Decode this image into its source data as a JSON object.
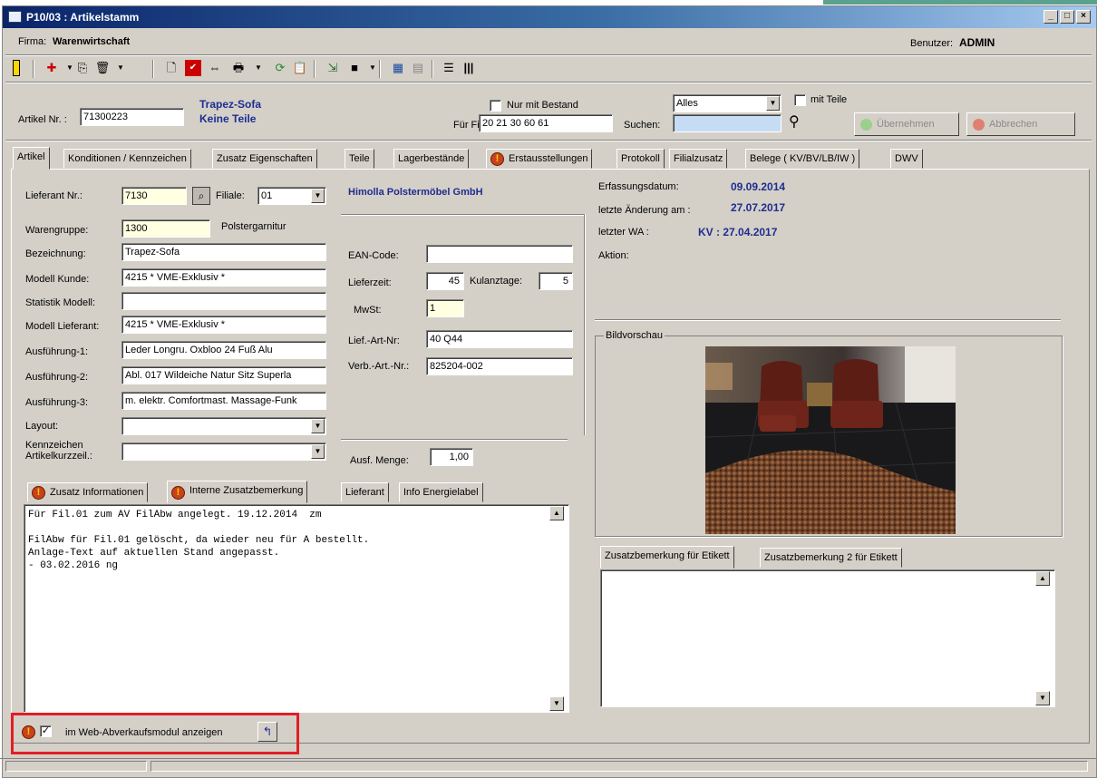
{
  "window": {
    "title": "P10/03 : Artikelstamm"
  },
  "header": {
    "firma_label": "Firma:",
    "firma": "Warenwirtschaft",
    "benutzer_label": "Benutzer:",
    "benutzer": "ADMIN"
  },
  "search": {
    "artikel_label": "Artikel Nr. :",
    "artikel_value": "71300223",
    "name_line1": "Trapez-Sofa",
    "name_line2": "Keine Teile",
    "nur_bestand_label": "Nur mit Bestand",
    "fuer_fil_label": "Für Fil:",
    "fuer_fil_value": "20 21 30 60 61",
    "filter_value": "Alles",
    "mit_teile_label": "mit Teile",
    "suchen_label": "Suchen:",
    "suchen_value": "",
    "uebernehmen": "Übernehmen",
    "abbrechen": "Abbrechen"
  },
  "tabs": [
    "Artikel",
    "Konditionen / Kennzeichen",
    "Zusatz Eigenschaften",
    "Teile",
    "Lagerbestände",
    "Erstausstellungen",
    "Protokoll",
    "Filialzusatz",
    "Belege ( KV/BV/LB/IW )",
    "DWV"
  ],
  "form": {
    "lieferant_label": "Lieferant Nr.:",
    "lieferant_value": "7130",
    "filiale_label": "Filiale:",
    "filiale_value": "01",
    "lieferant_name": "Himolla Polstermöbel GmbH",
    "warengruppe_label": "Warengruppe:",
    "warengruppe_value": "1300",
    "warengruppe_text": "Polstergarnitur",
    "bezeichnung_label": "Bezeichnung:",
    "bezeichnung_value": "Trapez-Sofa",
    "modell_kunde_label": "Modell Kunde:",
    "modell_kunde_value": "4215 * VME-Exklusiv *",
    "statistik_label": "Statistik Modell:",
    "statistik_value": "",
    "modell_lieferant_label": "Modell Lieferant:",
    "modell_lieferant_value": "4215 * VME-Exklusiv *",
    "ausf1_label": "Ausführung-1:",
    "ausf1_value": "Leder Longru. Oxbloo 24 Fuß Alu",
    "ausf2_label": "Ausführung-2:",
    "ausf2_value": "Abl. 017 Wildeiche Natur Sitz Superla",
    "ausf3_label": "Ausführung-3:",
    "ausf3_value": "m. elektr. Comfortmast. Massage-Funk",
    "layout_label": "Layout:",
    "kennzeichen_label1": "Kennzeichen",
    "kennzeichen_label2": "Artikelkurzzeil.:",
    "ean_label": "EAN-Code:",
    "ean_value": "",
    "lieferzeit_label": "Lieferzeit:",
    "lieferzeit_value": "45",
    "kulanz_label": "Kulanztage:",
    "kulanz_value": "5",
    "mwst_label": "MwSt:",
    "mwst_value": "1",
    "lief_art_label": "Lief.-Art-Nr:",
    "lief_art_value": "40 Q44",
    "verb_art_label": "Verb.-Art.-Nr.:",
    "verb_art_value": "825204-002",
    "ausf_menge_label": "Ausf. Menge:",
    "ausf_menge_value": "1,00"
  },
  "info": {
    "erfassung_label": "Erfassungsdatum:",
    "erfassung_value": "09.09.2014",
    "aenderung_label": "letzte Änderung am :",
    "aenderung_value": "27.07.2017",
    "wa_label": "letzter WA :",
    "wa_value": "KV : 27.04.2017",
    "aktion_label": "Aktion:",
    "bildvorschau_label": "Bildvorschau"
  },
  "subtabs": [
    "Zusatz Informationen",
    "Interne Zusatzbemerkung",
    "Lieferant",
    "Info Energielabel"
  ],
  "memo_text": "Für Fil.01 zum AV FilAbw angelegt. 19.12.2014  zm\n\nFilAbw für Fil.01 gelöscht, da wieder neu für A bestellt.\nAnlage-Text auf aktuellen Stand angepasst.\n- 03.02.2016 ng",
  "etikett_tabs": [
    "Zusatzbemerkung für Etikett",
    "Zusatzbemerkung 2 für Etikett"
  ],
  "web": {
    "label": "im Web-Abverkaufsmodul anzeigen"
  },
  "colors": {
    "accent": "#1e2d8f",
    "highlight": "#e31e24"
  }
}
